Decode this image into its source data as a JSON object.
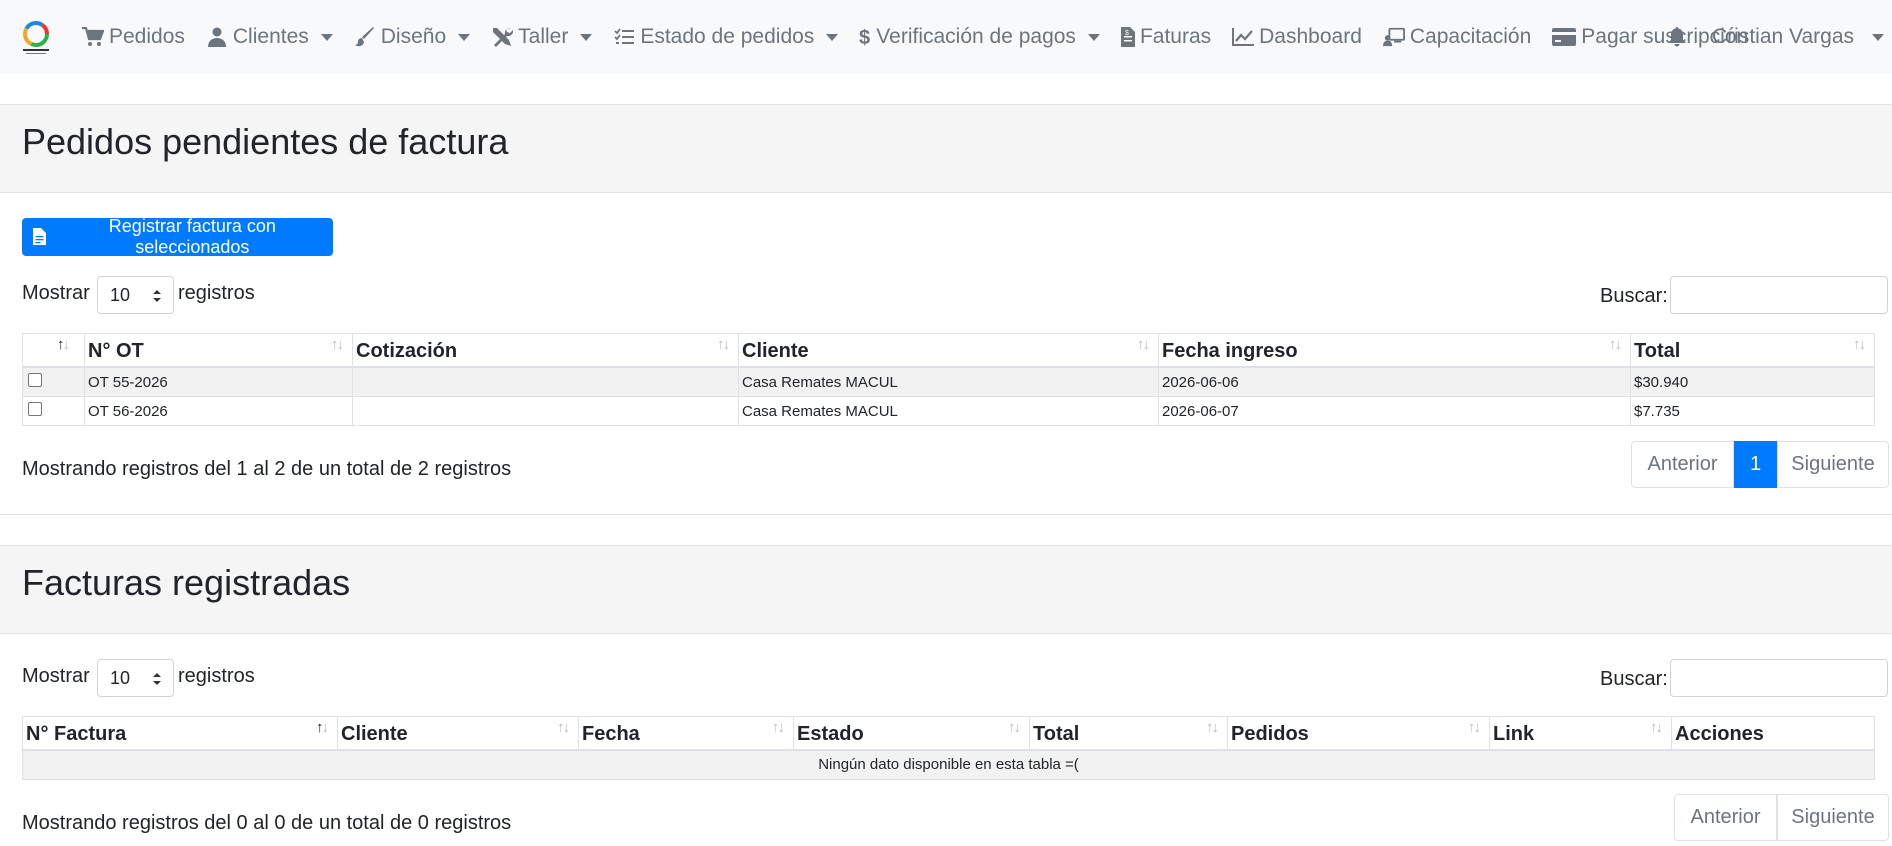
{
  "nav": {
    "items": [
      {
        "label": "Pedidos",
        "icon": "cart-icon",
        "dropdown": false
      },
      {
        "label": "Clientes",
        "icon": "user-icon",
        "dropdown": true
      },
      {
        "label": "Diseño",
        "icon": "brush-icon",
        "dropdown": true
      },
      {
        "label": "Taller",
        "icon": "tools-icon",
        "dropdown": true
      },
      {
        "label": "Estado de pedidos",
        "icon": "tasks-icon",
        "dropdown": true
      },
      {
        "label": "Verificación de pagos",
        "icon": "dollar-icon",
        "dropdown": true
      },
      {
        "label": "Faturas",
        "icon": "invoice-icon",
        "dropdown": false
      },
      {
        "label": "Dashboard",
        "icon": "chart-line-icon",
        "dropdown": false
      },
      {
        "label": "Capacitación",
        "icon": "teacher-icon",
        "dropdown": false
      },
      {
        "label": "Pagar suscripción",
        "icon": "credit-card-icon",
        "dropdown": false
      }
    ],
    "user": "Cristian Vargas"
  },
  "pending": {
    "title": "Pedidos pendientes de factura",
    "register_button": "Registrar factura con seleccionados",
    "show_label": "Mostrar",
    "length_value": "10",
    "records_label": "registros",
    "search_label": "Buscar:",
    "columns": [
      "",
      "N° OT",
      "Cotización",
      "Cliente",
      "Fecha ingreso",
      "Total"
    ],
    "rows": [
      {
        "ot": "OT 55-2026",
        "cotizacion": "",
        "cliente": "Casa Remates MACUL",
        "fecha": "2026-06-06",
        "total": "$30.940"
      },
      {
        "ot": "OT 56-2026",
        "cotizacion": "",
        "cliente": "Casa Remates MACUL",
        "fecha": "2026-06-07",
        "total": "$7.735"
      }
    ],
    "info": "Mostrando registros del 1 al 2 de un total de 2 registros",
    "prev": "Anterior",
    "page": "1",
    "next": "Siguiente"
  },
  "invoices": {
    "title": "Facturas registradas",
    "show_label": "Mostrar",
    "length_value": "10",
    "records_label": "registros",
    "search_label": "Buscar:",
    "columns": [
      "N° Factura",
      "Cliente",
      "Fecha",
      "Estado",
      "Total",
      "Pedidos",
      "Link",
      "Acciones"
    ],
    "empty": "Ningún dato disponible en esta tabla =(",
    "info": "Mostrando registros del 0 al 0 de un total de 0 registros",
    "prev": "Anterior",
    "next": "Siguiente"
  },
  "colors": {
    "primary": "#007bff",
    "navbar_bg": "#f8f9fa",
    "section_bg": "#f5f5f5"
  }
}
